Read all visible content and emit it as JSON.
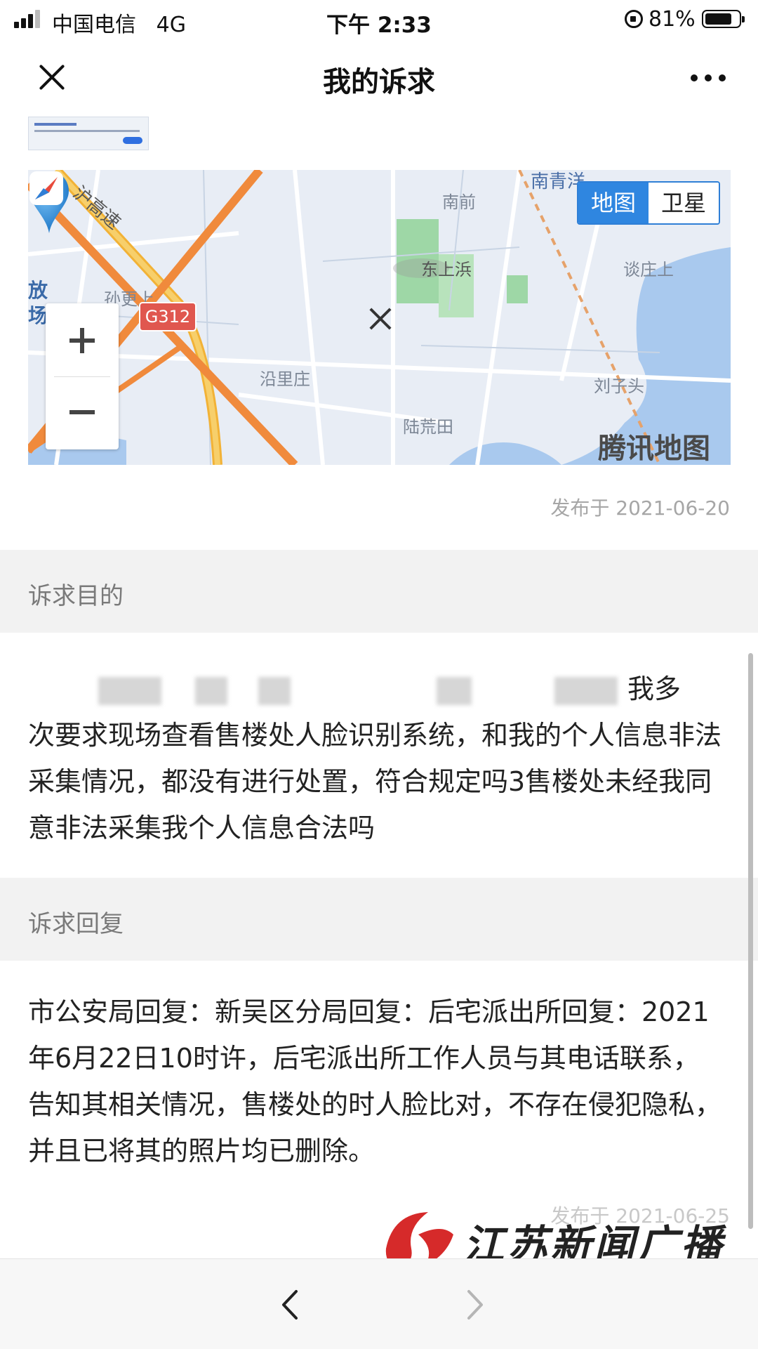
{
  "status_bar": {
    "carrier": "中国电信",
    "network": "4G",
    "time": "下午 2:33",
    "battery_percent": "81%",
    "battery_level": 0.81
  },
  "nav": {
    "title": "我的诉求",
    "close_icon": "close-icon",
    "more_icon": "more-icon"
  },
  "map": {
    "type_toggle": {
      "map_label": "地图",
      "satellite_label": "卫星",
      "selected": "地图"
    },
    "labels": {
      "expressway": "沪高速",
      "nanqian": "南前",
      "nanqing": "南青洋",
      "dongshangbang": "东上浜",
      "tanzhuangshang": "谈庄上",
      "fang": "放",
      "chang": "场",
      "sungengshang": "孙更上",
      "yanlizhuang": "沿里庄",
      "liuzitou": "刘子头",
      "luhuangtian": "陆荒田",
      "road_g312": "G312"
    },
    "brand": "腾讯地图",
    "accent": "#2f86e0"
  },
  "post": {
    "published_1": "发布于 2021-06-20",
    "purpose_header": "诉求目的",
    "purpose_tail_line1": "我多",
    "purpose_rest": "次要求现场查看售楼处人脸识别系统，和我的个人信息非法采集情况，都没有进行处置，符合规定吗3售楼处未经我同意非法采集我个人信息合法吗",
    "reply_header": "诉求回复",
    "reply_text": "市公安局回复：新吴区分局回复：后宅派出所回复：2021年6月22日10时许，后宅派出所工作人员与其电话联系，告知其相关情况，售楼处的时人脸比对，不存在侵犯隐私，并且已将其的照片均已删除。",
    "published_2": "发布于 2021-06-25"
  },
  "watermark": {
    "text": "江苏新闻广播",
    "color": "#d62a2a"
  },
  "toolbar": {
    "back_icon": "chevron-left-icon",
    "forward_icon": "chevron-right-icon"
  }
}
